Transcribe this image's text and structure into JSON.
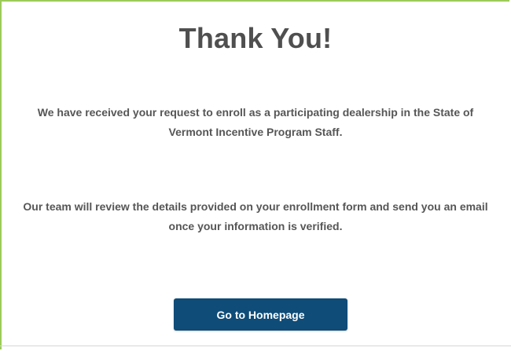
{
  "page": {
    "title": "Thank You!",
    "paragraph_1": "We have received your request to enroll as a participating dealership in the State of Vermont Incentive Program Staff.",
    "paragraph_2": "Our team will review the details provided on your enrollment form and send you an email once your information is verified.",
    "button_label": "Go to Homepage"
  },
  "colors": {
    "frame_border": "#9ccb5a",
    "button_bg": "#0f4c78",
    "title_text": "#4f4f4f"
  }
}
